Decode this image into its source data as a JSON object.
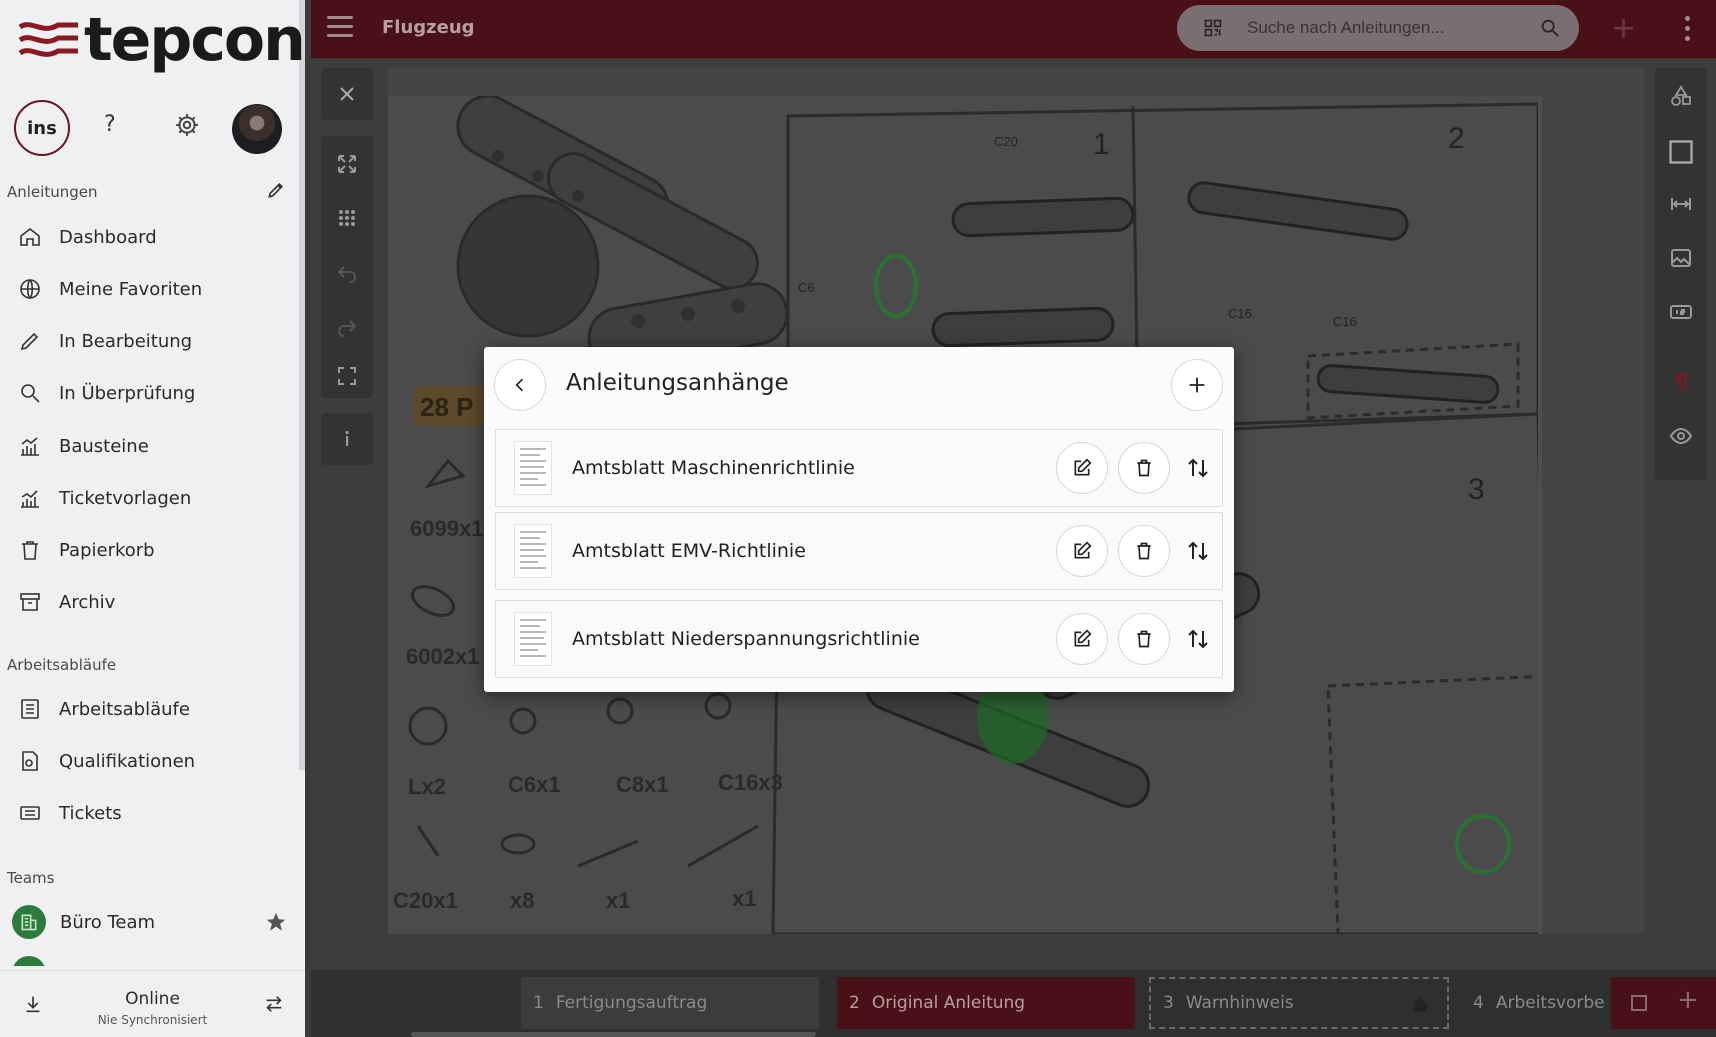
{
  "app": {
    "logo_text": "tepcon"
  },
  "sidebar": {
    "ins_label": "ins",
    "help_label": "?",
    "sections": {
      "instructions": "Anleitungen",
      "workflows": "Arbeitsabläufe",
      "teams": "Teams"
    },
    "items": [
      {
        "label": "Dashboard",
        "icon": "home-icon"
      },
      {
        "label": "Meine Favoriten",
        "icon": "globe-icon"
      },
      {
        "label": "In Bearbeitung",
        "icon": "pencil-icon"
      },
      {
        "label": "In Überprüfung",
        "icon": "search-icon"
      },
      {
        "label": "Bausteine",
        "icon": "chart-icon"
      },
      {
        "label": "Ticketvorlagen",
        "icon": "chart-line-icon"
      },
      {
        "label": "Papierkorb",
        "icon": "trash-icon"
      },
      {
        "label": "Archiv",
        "icon": "archive-icon"
      }
    ],
    "workflow_items": [
      {
        "label": "Arbeitsabläufe",
        "icon": "list-icon"
      },
      {
        "label": "Qualifikationen",
        "icon": "certificate-icon"
      },
      {
        "label": "Tickets",
        "icon": "ticket-icon"
      }
    ],
    "teams": [
      {
        "label": "Büro Team",
        "icon": "building-icon"
      }
    ],
    "sync": {
      "status": "Online",
      "sub": "Nie Synchronisiert"
    }
  },
  "header": {
    "title": "Flugzeug",
    "search_placeholder": "Suche nach Anleitungen..."
  },
  "dialog": {
    "title": "Anleitungsanhänge",
    "attachments": [
      {
        "name": "Amtsblatt Maschinenrichtlinie"
      },
      {
        "name": "Amtsblatt EMV-Richtlinie"
      },
      {
        "name": "Amtsblatt Niederspannungsrichtlinie"
      }
    ]
  },
  "bottom_tabs": [
    {
      "num": "1",
      "label": "Fertigungsauftrag"
    },
    {
      "num": "2",
      "label": "Original Anleitung"
    },
    {
      "num": "3",
      "label": "Warnhinweis"
    },
    {
      "num": "4",
      "label": "Arbeitsvorbe"
    }
  ],
  "canvas": {
    "panel_numbers": [
      "1",
      "2",
      "3"
    ],
    "part_labels": [
      "6099x1",
      "6002x1",
      "Lx2",
      "C6x1",
      "C8x1",
      "C16x3",
      "C20x1",
      "x8",
      "x1",
      "x1"
    ],
    "price_tag": "28 P",
    "screw_labels": [
      "C20",
      "C6",
      "C16",
      "C16"
    ]
  },
  "colors": {
    "brand": "#4a1018",
    "accent_tab": "#4a1018",
    "sidebar_bg": "#eef0f1"
  }
}
